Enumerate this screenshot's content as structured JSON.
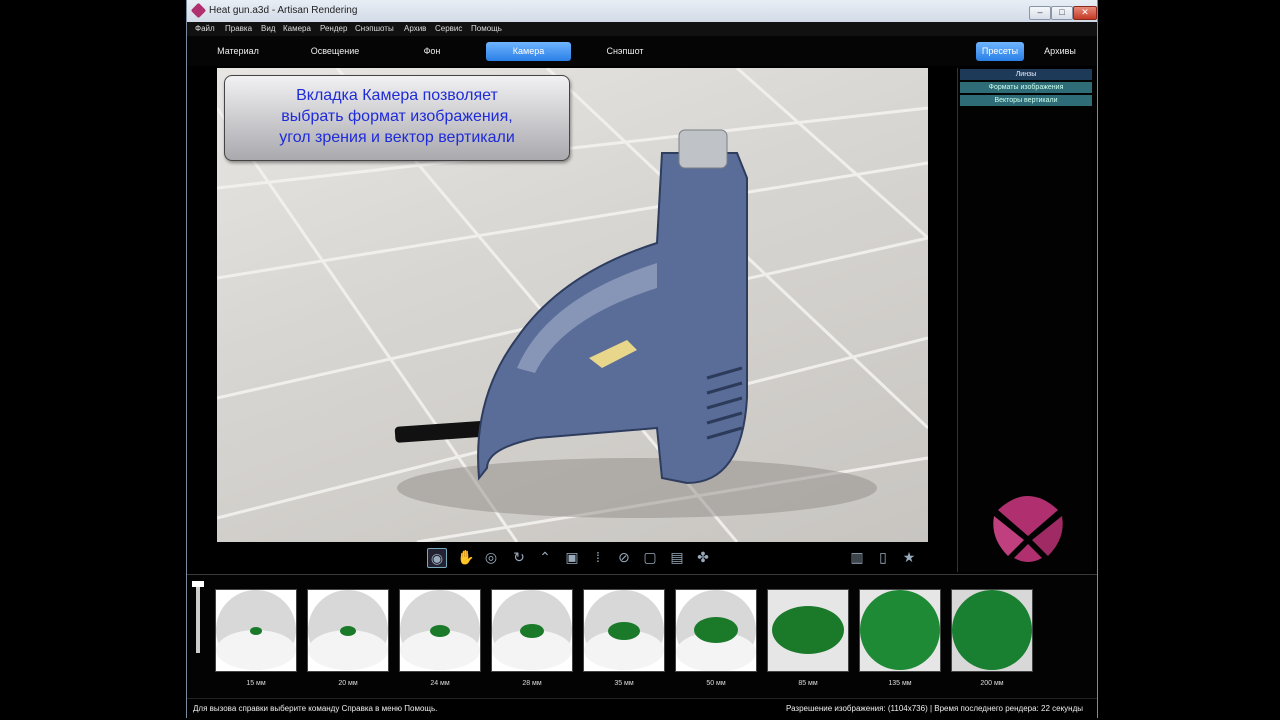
{
  "window": {
    "title": "Heat gun.a3d - Artisan Rendering"
  },
  "menu": [
    "Файл",
    "Правка",
    "Вид",
    "Камера",
    "Рендер",
    "Снэпшоты",
    "Архив",
    "Сервис",
    "Помощь"
  ],
  "tabs": [
    {
      "label": "Материал"
    },
    {
      "label": "Освещение"
    },
    {
      "label": "Фон"
    },
    {
      "label": "Камера"
    },
    {
      "label": "Снэпшот"
    }
  ],
  "right_tabs": [
    {
      "label": "Пресеты"
    },
    {
      "label": "Архивы"
    }
  ],
  "callout": {
    "line1": "Вкладка Камера позволяет",
    "line2": "выбрать формат изображения,",
    "line3": "угол зрения и вектор вертикали"
  },
  "presets": {
    "header": "Линзы",
    "items": [
      "Форматы изображения",
      "Векторы вертикали"
    ]
  },
  "thumbnails": [
    {
      "label": "15 мм"
    },
    {
      "label": "20 мм"
    },
    {
      "label": "24 мм"
    },
    {
      "label": "28 мм"
    },
    {
      "label": "35 мм"
    },
    {
      "label": "50 мм"
    },
    {
      "label": "85 мм"
    },
    {
      "label": "135 мм"
    },
    {
      "label": "200 мм"
    }
  ],
  "status": {
    "left": "Для вызова справки выберите команду Справка в меню Помощь.",
    "right": "Разрешение изображения: (1104x736)  |  Время последнего рендера: 22 секунды"
  },
  "colors": {
    "accent": "#2a7fe6",
    "callout_text": "#1f2bd8",
    "logo": "#b0306f"
  }
}
